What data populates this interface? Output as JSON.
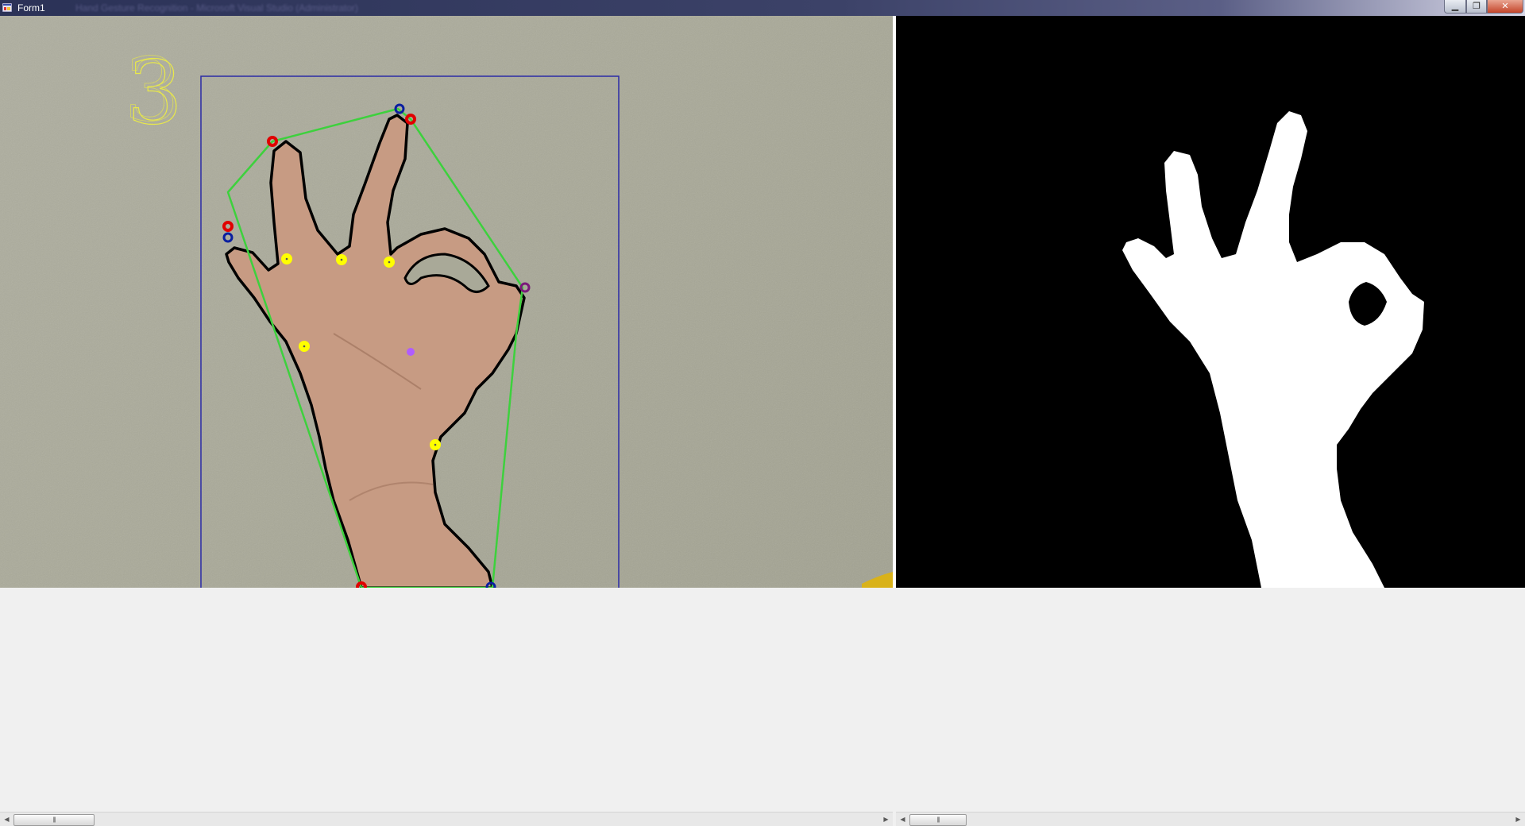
{
  "window": {
    "title": "Form1",
    "blurred_caption": "Hand Gesture Recognition - Microsoft Visual Studio (Administrator)",
    "buttons": {
      "minimize": "▁",
      "maximize": "❐",
      "close": "✕"
    }
  },
  "panels": {
    "camera_view": {
      "gesture_count": "3"
    },
    "mask_view": {}
  },
  "colors": {
    "convex_hull": "#3dd13d",
    "contour": "#000000",
    "fingertip_marker": "#e00000",
    "start_point_marker": "#0a1ea0",
    "defect_marker": "#ffff00",
    "palm_center": "#b05cff",
    "bounding_box": "#2b2ba6",
    "mask_foreground": "#ffffff",
    "mask_background": "#000000"
  },
  "scrollbars": {
    "thumb_grip": "|||"
  }
}
